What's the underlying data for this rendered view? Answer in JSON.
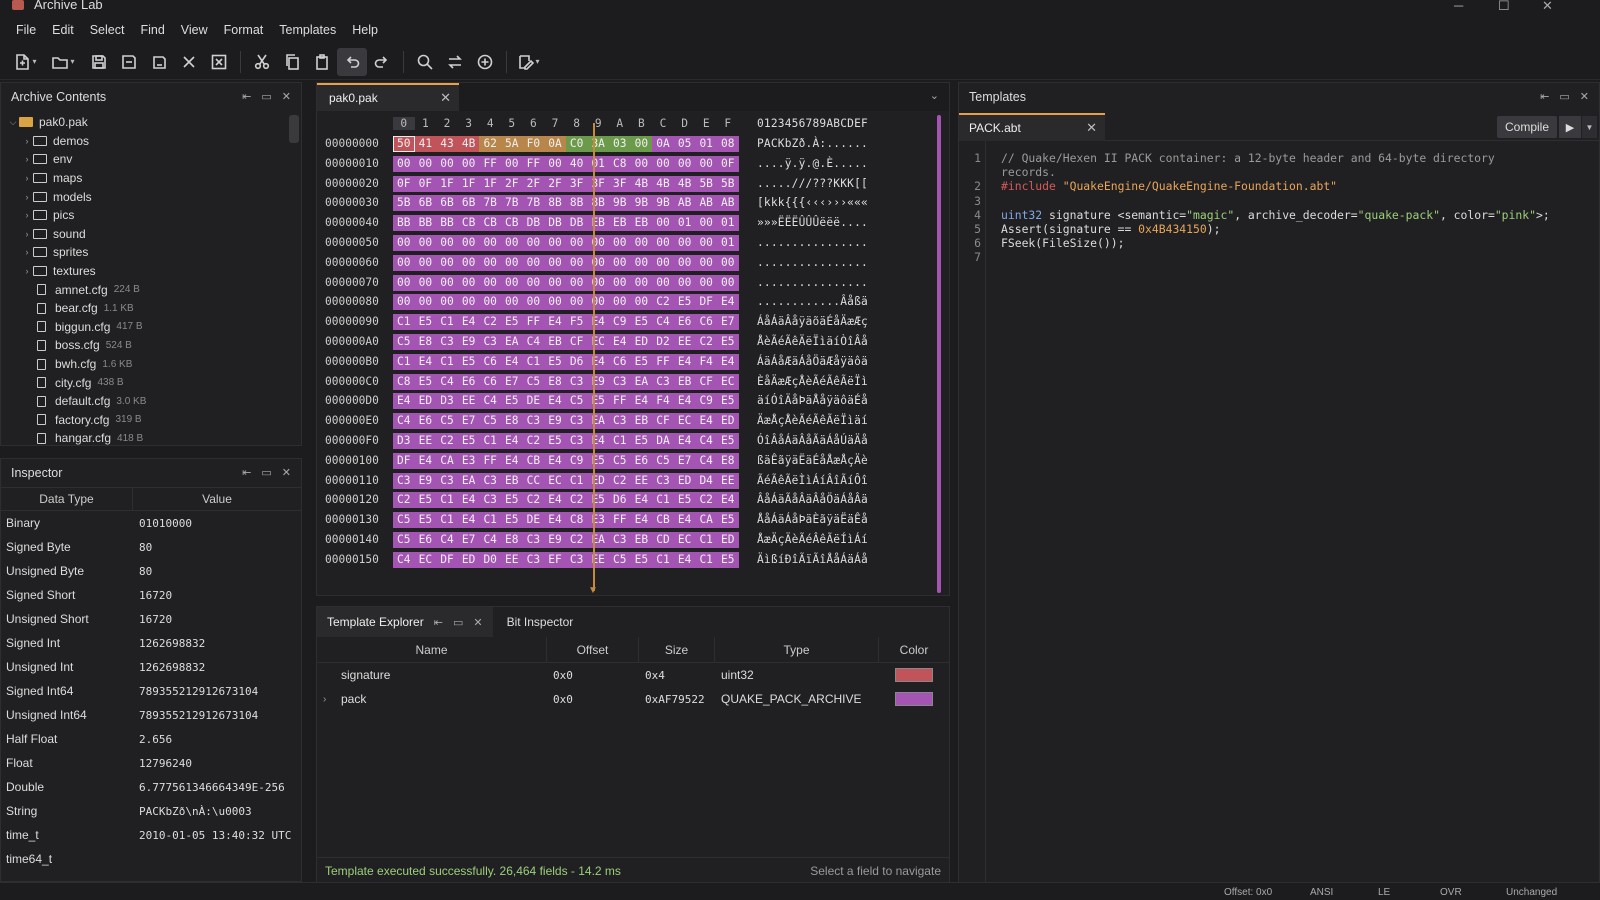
{
  "app": {
    "title": "Archive Lab"
  },
  "menu": [
    "File",
    "Edit",
    "Select",
    "Find",
    "View",
    "Format",
    "Templates",
    "Help"
  ],
  "toolbar": [
    "new-file-icon",
    "open-folder-icon",
    "save-icon",
    "save-as-icon",
    "save-all-icon",
    "close-icon",
    "close-all-icon",
    "cut-icon",
    "copy-icon",
    "paste-icon",
    "undo-icon",
    "redo-icon",
    "find-icon",
    "replace-icon",
    "goto-icon",
    "template-run-icon"
  ],
  "archive": {
    "title": "Archive Contents",
    "root": "pak0.pak",
    "folders": [
      "demos",
      "env",
      "maps",
      "models",
      "pics",
      "sound",
      "sprites",
      "textures"
    ],
    "files": [
      {
        "name": "amnet.cfg",
        "size": "224 B"
      },
      {
        "name": "bear.cfg",
        "size": "1.1 KB"
      },
      {
        "name": "biggun.cfg",
        "size": "417 B"
      },
      {
        "name": "boss.cfg",
        "size": "524 B"
      },
      {
        "name": "bwh.cfg",
        "size": "1.6 KB"
      },
      {
        "name": "city.cfg",
        "size": "438 B"
      },
      {
        "name": "default.cfg",
        "size": "3.0 KB"
      },
      {
        "name": "factory.cfg",
        "size": "319 B"
      },
      {
        "name": "hangar.cfg",
        "size": "418 B"
      }
    ]
  },
  "inspector": {
    "title": "Inspector",
    "col_type": "Data Type",
    "col_value": "Value",
    "rows": [
      {
        "k": "Binary",
        "v": "01010000"
      },
      {
        "k": "Signed Byte",
        "v": "80"
      },
      {
        "k": "Unsigned Byte",
        "v": "80"
      },
      {
        "k": "Signed Short",
        "v": "16720"
      },
      {
        "k": "Unsigned Short",
        "v": "16720"
      },
      {
        "k": "Signed Int",
        "v": "1262698832"
      },
      {
        "k": "Unsigned Int",
        "v": "1262698832"
      },
      {
        "k": "Signed Int64",
        "v": "789355212912673104"
      },
      {
        "k": "Unsigned Int64",
        "v": "789355212912673104"
      },
      {
        "k": "Half Float",
        "v": "2.656"
      },
      {
        "k": "Float",
        "v": "12796240"
      },
      {
        "k": "Double",
        "v": "6.777561346664349E-256"
      },
      {
        "k": "String",
        "v": "PACKbZð\\nÀ:\\u0003"
      },
      {
        "k": "time_t",
        "v": "2010-01-05 13:40:32 UTC"
      },
      {
        "k": "time64_t",
        "v": ""
      }
    ]
  },
  "hex": {
    "tab": "pak0.pak",
    "columns": [
      "0",
      "1",
      "2",
      "3",
      "4",
      "5",
      "6",
      "7",
      "8",
      "9",
      "A",
      "B",
      "C",
      "D",
      "E",
      "F"
    ],
    "ascii_header": "0123456789ABCDEF",
    "rows": [
      {
        "off": "00000000",
        "bytes": [
          "50",
          "41",
          "43",
          "4B",
          "62",
          "5A",
          "F0",
          "0A",
          "C0",
          "3A",
          "03",
          "00",
          "0A",
          "05",
          "01",
          "08"
        ],
        "ascii": "PACKbZð.À:......"
      },
      {
        "off": "00000010",
        "bytes": [
          "00",
          "00",
          "00",
          "00",
          "FF",
          "00",
          "FF",
          "00",
          "40",
          "01",
          "C8",
          "00",
          "00",
          "00",
          "00",
          "0F"
        ],
        "ascii": "....ÿ.ÿ.@.È....."
      },
      {
        "off": "00000020",
        "bytes": [
          "0F",
          "0F",
          "1F",
          "1F",
          "1F",
          "2F",
          "2F",
          "2F",
          "3F",
          "3F",
          "3F",
          "4B",
          "4B",
          "4B",
          "5B",
          "5B"
        ],
        "ascii": ".....///???KKK[["
      },
      {
        "off": "00000030",
        "bytes": [
          "5B",
          "6B",
          "6B",
          "6B",
          "7B",
          "7B",
          "7B",
          "8B",
          "8B",
          "8B",
          "9B",
          "9B",
          "9B",
          "AB",
          "AB",
          "AB"
        ],
        "ascii": "[kkk{{{‹‹‹›››«««"
      },
      {
        "off": "00000040",
        "bytes": [
          "BB",
          "BB",
          "BB",
          "CB",
          "CB",
          "CB",
          "DB",
          "DB",
          "DB",
          "EB",
          "EB",
          "EB",
          "00",
          "01",
          "00",
          "01"
        ],
        "ascii": "»»»ËËËÛÛÛëëë...."
      },
      {
        "off": "00000050",
        "bytes": [
          "00",
          "00",
          "00",
          "00",
          "00",
          "00",
          "00",
          "00",
          "00",
          "00",
          "00",
          "00",
          "00",
          "00",
          "00",
          "01"
        ],
        "ascii": "................"
      },
      {
        "off": "00000060",
        "bytes": [
          "00",
          "00",
          "00",
          "00",
          "00",
          "00",
          "00",
          "00",
          "00",
          "00",
          "00",
          "00",
          "00",
          "00",
          "00",
          "00"
        ],
        "ascii": "................"
      },
      {
        "off": "00000070",
        "bytes": [
          "00",
          "00",
          "00",
          "00",
          "00",
          "00",
          "00",
          "00",
          "00",
          "00",
          "00",
          "00",
          "00",
          "00",
          "00",
          "00"
        ],
        "ascii": "................"
      },
      {
        "off": "00000080",
        "bytes": [
          "00",
          "00",
          "00",
          "00",
          "00",
          "00",
          "00",
          "00",
          "00",
          "00",
          "00",
          "00",
          "C2",
          "E5",
          "DF",
          "E4"
        ],
        "ascii": "............Âåßä"
      },
      {
        "off": "00000090",
        "bytes": [
          "C1",
          "E5",
          "C1",
          "E4",
          "C2",
          "E5",
          "FF",
          "E4",
          "F5",
          "E4",
          "C9",
          "E5",
          "C4",
          "E6",
          "C6",
          "E7"
        ],
        "ascii": "ÁåÁäÂåÿäõäÉåÄæÆç"
      },
      {
        "off": "000000A0",
        "bytes": [
          "C5",
          "E8",
          "C3",
          "E9",
          "C3",
          "EA",
          "C4",
          "EB",
          "CF",
          "EC",
          "E4",
          "ED",
          "D2",
          "EE",
          "C2",
          "E5"
        ],
        "ascii": "ÅèÃéÃêÄëÏìäíÒîÂå"
      },
      {
        "off": "000000B0",
        "bytes": [
          "C1",
          "E4",
          "C1",
          "E5",
          "C6",
          "E4",
          "C1",
          "E5",
          "D6",
          "E4",
          "C6",
          "E5",
          "FF",
          "E4",
          "F4",
          "E4"
        ],
        "ascii": "ÁäÁåÆäÁåÖäÆåÿäôä"
      },
      {
        "off": "000000C0",
        "bytes": [
          "C8",
          "E5",
          "C4",
          "E6",
          "C6",
          "E7",
          "C5",
          "E8",
          "C3",
          "E9",
          "C3",
          "EA",
          "C3",
          "EB",
          "CF",
          "EC"
        ],
        "ascii": "ÈåÄæÆçÅèÃéÃêÃëÏì"
      },
      {
        "off": "000000D0",
        "bytes": [
          "E4",
          "ED",
          "D3",
          "EE",
          "C4",
          "E5",
          "DE",
          "E4",
          "C5",
          "E5",
          "FF",
          "E4",
          "F4",
          "E4",
          "C9",
          "E5"
        ],
        "ascii": "äíÓîÄåÞäÅåÿäôäÉå"
      },
      {
        "off": "000000E0",
        "bytes": [
          "C4",
          "E6",
          "C5",
          "E7",
          "C5",
          "E8",
          "C3",
          "E9",
          "C3",
          "EA",
          "C3",
          "EB",
          "CF",
          "EC",
          "E4",
          "ED"
        ],
        "ascii": "ÄæÅçÅèÃéÃêÃëÏìäí"
      },
      {
        "off": "000000F0",
        "bytes": [
          "D3",
          "EE",
          "C2",
          "E5",
          "C1",
          "E4",
          "C2",
          "E5",
          "C3",
          "E4",
          "C1",
          "E5",
          "DA",
          "E4",
          "C4",
          "E5"
        ],
        "ascii": "ÓîÂåÁäÂåÃäÁåÚäÄå"
      },
      {
        "off": "00000100",
        "bytes": [
          "DF",
          "E4",
          "CA",
          "E3",
          "FF",
          "E4",
          "CB",
          "E4",
          "C9",
          "E5",
          "C5",
          "E6",
          "C5",
          "E7",
          "C4",
          "E8"
        ],
        "ascii": "ßäÊãÿäËäÉåÅæÅçÄè"
      },
      {
        "off": "00000110",
        "bytes": [
          "C3",
          "E9",
          "C3",
          "EA",
          "C3",
          "EB",
          "CC",
          "EC",
          "C1",
          "ED",
          "C2",
          "EE",
          "C3",
          "ED",
          "D4",
          "EE"
        ],
        "ascii": "ÃéÃêÃëÌìÁíÂîÃíÔî"
      },
      {
        "off": "00000120",
        "bytes": [
          "C2",
          "E5",
          "C1",
          "E4",
          "C3",
          "E5",
          "C2",
          "E4",
          "C2",
          "E5",
          "D6",
          "E4",
          "C1",
          "E5",
          "C2",
          "E4"
        ],
        "ascii": "ÂåÁäÃåÂäÂåÖäÁåÂä"
      },
      {
        "off": "00000130",
        "bytes": [
          "C5",
          "E5",
          "C1",
          "E4",
          "C1",
          "E5",
          "DE",
          "E4",
          "C8",
          "E3",
          "FF",
          "E4",
          "CB",
          "E4",
          "CA",
          "E5"
        ],
        "ascii": "ÅåÁäÁåÞäÈãÿäËäÊå"
      },
      {
        "off": "00000140",
        "bytes": [
          "C5",
          "E6",
          "C4",
          "E7",
          "C4",
          "E8",
          "C3",
          "E9",
          "C2",
          "EA",
          "C3",
          "EB",
          "CD",
          "EC",
          "C1",
          "ED"
        ],
        "ascii": "ÅæÄçÄèÃéÂêÃëÍìÁí"
      },
      {
        "off": "00000150",
        "bytes": [
          "C4",
          "EC",
          "DF",
          "ED",
          "D0",
          "EE",
          "C3",
          "EF",
          "C3",
          "EE",
          "C5",
          "E5",
          "C1",
          "E4",
          "C1",
          "E5"
        ],
        "ascii": "ÄìßíÐîÃïÃîÅåÁäÁå"
      }
    ]
  },
  "template_explorer": {
    "tab": "Template Explorer",
    "tab2": "Bit Inspector",
    "headers": [
      "Name",
      "Offset",
      "Size",
      "Type",
      "Color"
    ],
    "rows": [
      {
        "name": "signature",
        "offset": "0x0",
        "size": "0x4",
        "type": "uint32",
        "color": "#c0545a"
      },
      {
        "name": "pack",
        "offset": "0x0",
        "size": "0xAF79522",
        "type": "QUAKE_PACK_ARCHIVE",
        "color": "#a455b4"
      }
    ],
    "status": "Template executed successfully. 26,464 fields - 14.2 ms",
    "hint": "Select a field to navigate"
  },
  "templates": {
    "title": "Templates",
    "tab": "PACK.abt",
    "compile": "Compile",
    "lines": [
      "1",
      "",
      "2",
      "3",
      "4",
      "5",
      "6",
      "7"
    ],
    "code": {
      "c1": "// Quake/Hexen II PACK container: a 12-byte header and 64-byte directory",
      "c1b": "records.",
      "inc_kw": "#include",
      "inc_str": "\"QuakeEngine/QuakeEngine-Foundation.abt\"",
      "l4_type": "uint32",
      "l4_a": " signature <semantic=",
      "l4_s1": "\"magic\"",
      "l4_b": ", archive_decoder=",
      "l4_s2": "\"quake-pack\"",
      "l4_c": ", color=",
      "l4_s3": "\"pink\"",
      "l4_d": ">;",
      "l5_a": "Assert(signature == ",
      "l5_n": "0x4B434150",
      "l5_b": ");",
      "l6": "FSeek(FileSize());"
    }
  },
  "statusbar": {
    "offset": "Offset: 0x0",
    "encoding": "ANSI",
    "endian": "LE",
    "mode": "OVR",
    "state": "Unchanged"
  },
  "colors": {
    "sig": "#c0545a",
    "pack": "#a455b4",
    "green": "#6a9a4a",
    "orange": "#b8864a",
    "accent": "#e6a04a"
  }
}
